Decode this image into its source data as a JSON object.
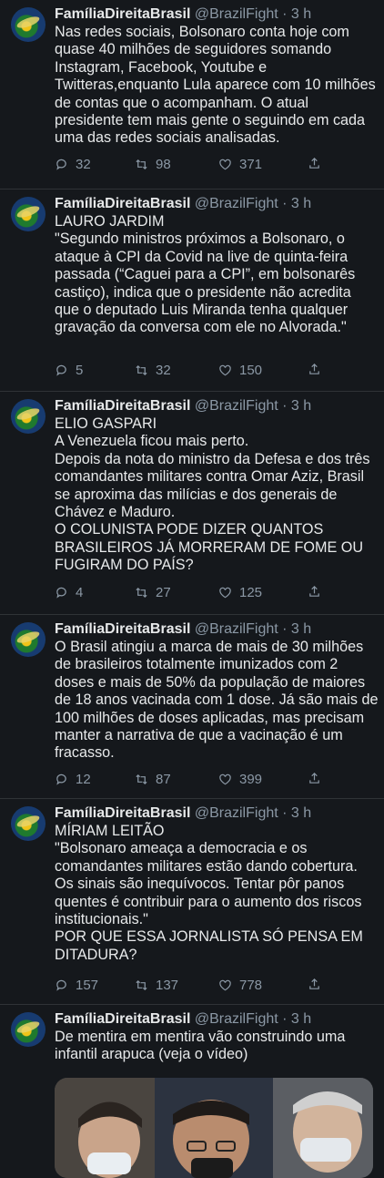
{
  "tweets": [
    {
      "name": "FamíliaDireitaBrasil",
      "handle": "@BrazilFight",
      "time": "· 3 h",
      "text": "Nas redes sociais, Bolsonaro conta hoje com quase 40 milhões de seguidores somando Instagram, Facebook, Youtube e Twitteras,enquanto Lula aparece com 10 milhões de contas que o acompanham. O atual presidente tem mais gente o seguindo em cada uma das  redes sociais analisadas.",
      "replies": "32",
      "retweets": "98",
      "likes": "371"
    },
    {
      "name": "FamíliaDireitaBrasil",
      "handle": "@BrazilFight",
      "time": "· 3 h",
      "text": "LAURO JARDIM\n\"Segundo ministros próximos a Bolsonaro, o ataque à CPI da Covid na live de quinta-feira passada (“Caguei para a CPI”, em bolsonarês castiço), indica que o presidente não acredita que o deputado Luis Miranda tenha qualquer gravação da conversa com ele no Alvorada.\"",
      "replies": "5",
      "retweets": "32",
      "likes": "150"
    },
    {
      "name": "FamíliaDireitaBrasil",
      "handle": "@BrazilFight",
      "time": "· 3 h",
      "text": "ELIO GASPARI\nA Venezuela ficou mais perto.\nDepois da nota do ministro da Defesa e dos três comandantes militares contra Omar Aziz, Brasil se aproxima das milícias e dos generais de Chávez e Maduro.\nO COLUNISTA PODE DIZER QUANTOS BRASILEIROS JÁ MORRERAM DE FOME OU FUGIRAM DO PAÍS?",
      "replies": "4",
      "retweets": "27",
      "likes": "125"
    },
    {
      "name": "FamíliaDireitaBrasil",
      "handle": "@BrazilFight",
      "time": "· 3 h",
      "text": "O Brasil atingiu a marca de mais de 30 milhões de brasileiros totalmente imunizados com 2 doses e mais de 50% da população de maiores de 18 anos vacinada com 1 dose. Já são mais de 100 milhões de doses aplicadas, mas precisam manter a narrativa de que a vacinação é um fracasso.",
      "replies": "12",
      "retweets": "87",
      "likes": "399"
    },
    {
      "name": "FamíliaDireitaBrasil",
      "handle": "@BrazilFight",
      "time": "· 3 h",
      "text": "MÍRIAM LEITÃO\n\"Bolsonaro ameaça a democracia e os comandantes militares estão dando cobertura. Os sinais são inequívocos. Tentar pôr panos quentes é contribuir para o aumento dos riscos institucionais.\"\nPOR QUE ESSA JORNALISTA SÓ PENSA EM DITADURA?",
      "replies": "157",
      "retweets": "137",
      "likes": "778"
    },
    {
      "name": "FamíliaDireitaBrasil",
      "handle": "@BrazilFight",
      "time": "· 3 h",
      "text": "De mentira em mentira vão construindo uma infantil arapuca (veja o vídeo)"
    }
  ]
}
